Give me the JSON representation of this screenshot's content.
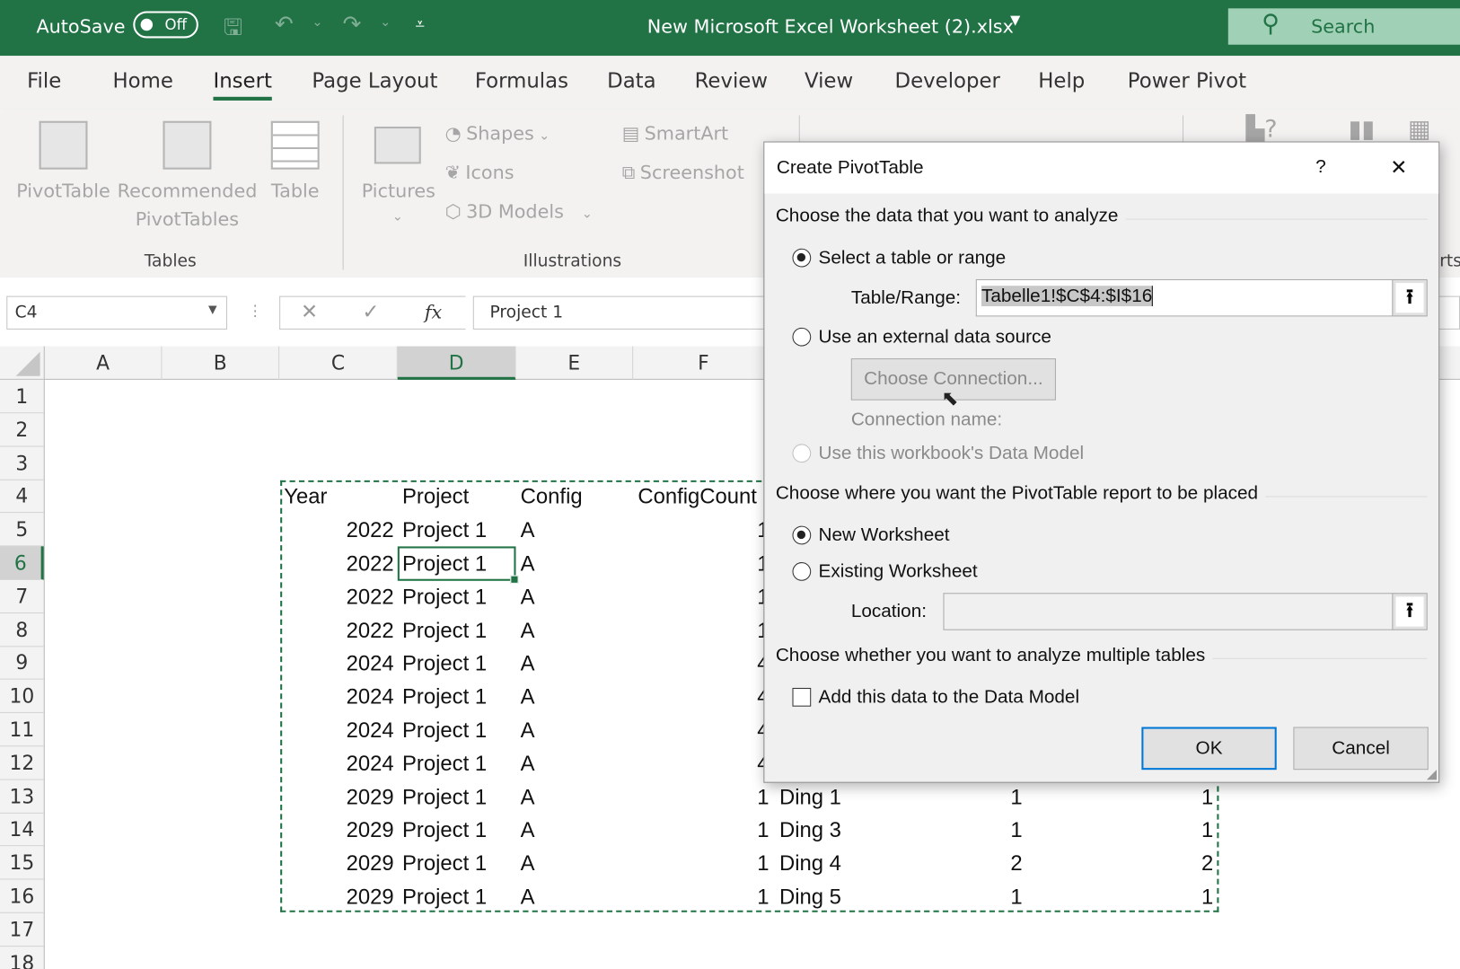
{
  "titlebar": {
    "autosave_label": "AutoSave",
    "autosave_state": "Off",
    "file_title": "New Microsoft Excel Worksheet (2).xlsx",
    "search_label": "Search",
    "accent": "#217346"
  },
  "tabs": [
    "File",
    "Home",
    "Insert",
    "Page Layout",
    "Formulas",
    "Data",
    "Review",
    "View",
    "Developer",
    "Help",
    "Power Pivot"
  ],
  "active_tab": "Insert",
  "ribbon": {
    "tables_group": "Tables",
    "pivottable": "PivotTable",
    "recommended_1": "Recommended",
    "recommended_2": "PivotTables",
    "table": "Table",
    "pictures": "Pictures",
    "shapes": "Shapes",
    "icons": "Icons",
    "models": "3D Models",
    "smartart": "SmartArt",
    "screenshot": "Screenshot",
    "illustrations_group": "Illustrations",
    "charts_partial": "rts"
  },
  "formula_bar": {
    "name_box": "C4",
    "fx": "fx",
    "value": "Project 1"
  },
  "columns": [
    "A",
    "B",
    "C",
    "D",
    "E",
    "F"
  ],
  "selected_column": "D",
  "rows": [
    "1",
    "2",
    "3",
    "4",
    "5",
    "6",
    "7",
    "8",
    "9",
    "10",
    "11",
    "12",
    "13",
    "14",
    "15",
    "16",
    "17",
    "18"
  ],
  "selected_row": "6",
  "sheet": {
    "headers": [
      "Year",
      "Project",
      "Config",
      "ConfigCount"
    ],
    "data": [
      [
        "2022",
        "Project 1",
        "A",
        "1",
        "",
        "",
        ""
      ],
      [
        "2022",
        "Project 1",
        "A",
        "1",
        "",
        "",
        ""
      ],
      [
        "2022",
        "Project 1",
        "A",
        "1",
        "",
        "",
        ""
      ],
      [
        "2022",
        "Project 1",
        "A",
        "1",
        "",
        "",
        ""
      ],
      [
        "2024",
        "Project 1",
        "A",
        "4",
        "",
        "",
        ""
      ],
      [
        "2024",
        "Project 1",
        "A",
        "4",
        "",
        "",
        ""
      ],
      [
        "2024",
        "Project 1",
        "A",
        "4",
        "",
        "",
        ""
      ],
      [
        "2024",
        "Project 1",
        "A",
        "4",
        "",
        "",
        ""
      ],
      [
        "2029",
        "Project 1",
        "A",
        "1",
        "Ding 1",
        "1",
        "1"
      ],
      [
        "2029",
        "Project 1",
        "A",
        "1",
        "Ding 3",
        "1",
        "1"
      ],
      [
        "2029",
        "Project 1",
        "A",
        "1",
        "Ding 4",
        "2",
        "2"
      ],
      [
        "2029",
        "Project 1",
        "A",
        "1",
        "Ding 5",
        "1",
        "1"
      ]
    ]
  },
  "dialog": {
    "title": "Create PivotTable",
    "help": "?",
    "close": "✕",
    "section1": "Choose the data that you want to analyze",
    "opt_table": "Select a table or range",
    "table_range_label": "Table/Range:",
    "table_range_value": "Tabelle1!$C$4:$I$16",
    "opt_external": "Use an external data source",
    "choose_connection": "Choose Connection...",
    "connection_name": "Connection name:",
    "opt_datamodel": "Use this workbook's Data Model",
    "section2": "Choose where you want the PivotTable report to be placed",
    "opt_new": "New Worksheet",
    "opt_existing": "Existing Worksheet",
    "location_label": "Location:",
    "location_value": "",
    "section3": "Choose whether you want to analyze multiple tables",
    "add_datamodel": "Add this data to the Data Model",
    "ok": "OK",
    "cancel": "Cancel"
  }
}
